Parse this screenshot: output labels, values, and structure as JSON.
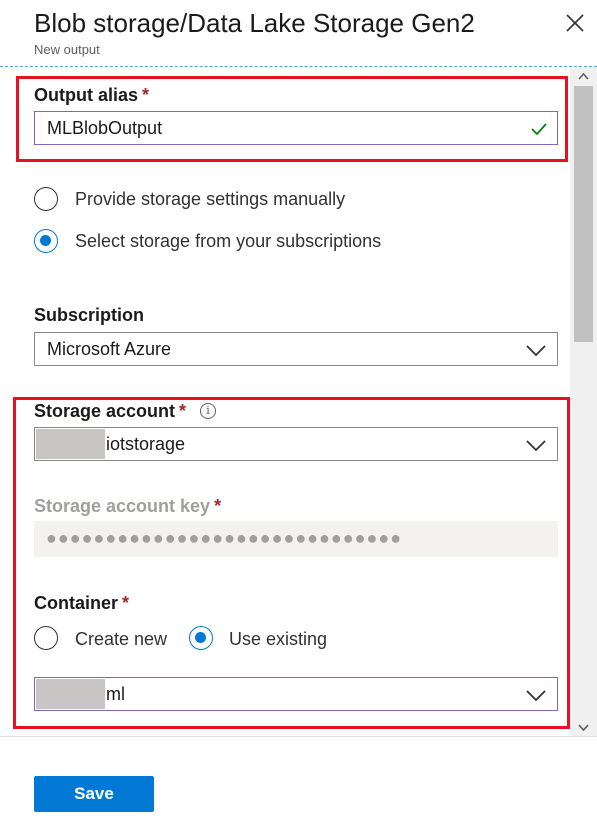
{
  "header": {
    "title": "Blob storage/Data Lake Storage Gen2",
    "subtitle": "New output",
    "close_icon": "close-icon"
  },
  "form": {
    "output_alias": {
      "label": "Output alias",
      "required": "*",
      "value": "MLBlobOutput",
      "valid_icon": "checkmark-icon"
    },
    "storage_mode": {
      "options": [
        "Provide storage settings manually",
        "Select storage from your subscriptions"
      ],
      "selected": "Select storage from your subscriptions"
    },
    "subscription": {
      "label": "Subscription",
      "value": "Microsoft Azure"
    },
    "storage_account": {
      "label": "Storage account",
      "required": "*",
      "value_suffix": "iotstorage",
      "info_icon": "info-icon"
    },
    "storage_account_key": {
      "label": "Storage account key",
      "required": "*",
      "masked_value": "●●●●●●●●●●●●●●●●●●●●●●●●●●●●●●"
    },
    "container": {
      "label": "Container",
      "required": "*",
      "options": [
        "Create new",
        "Use existing"
      ],
      "selected": "Use existing",
      "value_suffix": "ml"
    }
  },
  "footer": {
    "save_label": "Save"
  },
  "colors": {
    "accent": "#0078d4",
    "highlight": "#e81123",
    "required": "#a4262c",
    "valid": "#107c10"
  }
}
